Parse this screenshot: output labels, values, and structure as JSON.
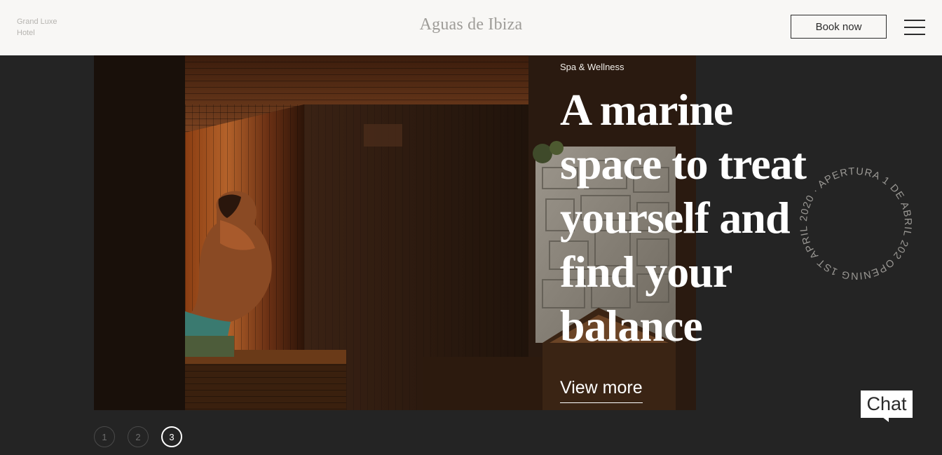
{
  "header": {
    "tagline_line1": "Grand Luxe",
    "tagline_line2": "Hotel",
    "logo": "Aguas de Ibiza",
    "book_label": "Book now"
  },
  "hero": {
    "category": "Spa & Wellness",
    "headline": "A marine\nspace to treat\nyourself and\nfind your\nbalance",
    "cta": "View more"
  },
  "badge": {
    "text": "OPENING 1ST APRIL 2020 · APERTURA 1 DE ABRIL 2020 · "
  },
  "chat": {
    "label": "Chat"
  },
  "pagination": {
    "pages": [
      "1",
      "2",
      "3"
    ],
    "active": 3
  },
  "icons": {
    "menu": "hamburger-menu-icon"
  },
  "colors": {
    "header_bg": "#f8f7f5",
    "page_bg": "#242424",
    "text_light": "#ffffff",
    "text_dark": "#2b2b2b"
  }
}
